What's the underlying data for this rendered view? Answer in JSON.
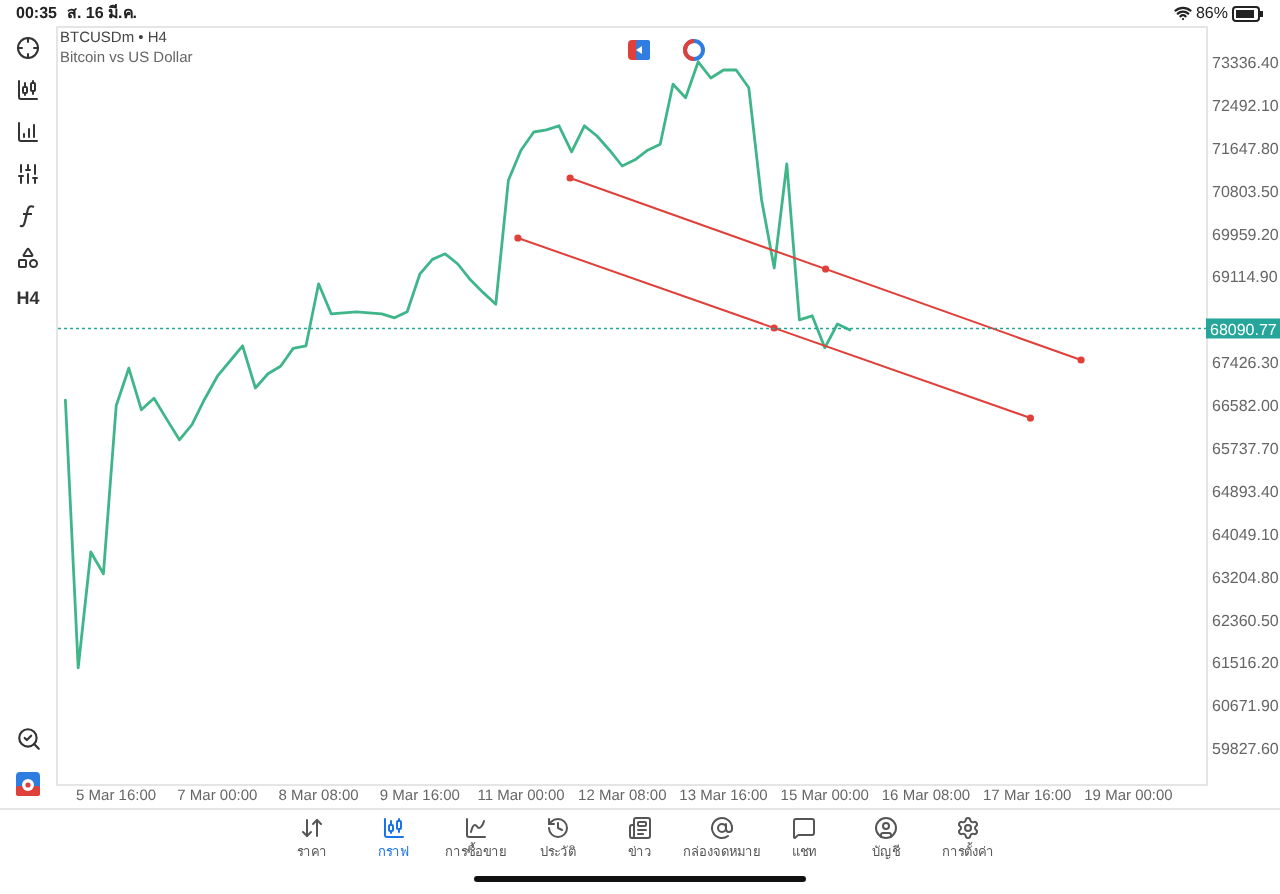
{
  "status_bar": {
    "time": "00:35",
    "date": "ส. 16 มี.ค.",
    "battery": "86%"
  },
  "chart_header": {
    "symbol": "BTCUSDm • H4",
    "description": "Bitcoin vs US Dollar"
  },
  "toolbar": {
    "timeframe": "H4"
  },
  "chart": {
    "chart_data": {
      "type": "line",
      "ylim": [
        59124,
        74045
      ],
      "categories": [
        null,
        null,
        null,
        null,
        "5 Mar 16:00",
        null,
        null,
        null,
        null,
        null,
        null,
        null,
        "7 Mar 00:00",
        null,
        null,
        null,
        null,
        null,
        null,
        null,
        "8 Mar 08:00",
        null,
        null,
        null,
        null,
        null,
        null,
        null,
        "9 Mar 16:00",
        null,
        null,
        null,
        null,
        null,
        null,
        null,
        "11 Mar 00:00",
        null,
        null,
        null,
        null,
        null,
        null,
        null,
        "12 Mar 08:00",
        null,
        null,
        null,
        null,
        null,
        null,
        null,
        "13 Mar 16:00",
        null,
        null,
        null,
        null,
        null,
        null,
        null,
        "15 Mar 00:00",
        null,
        null,
        null,
        null,
        null,
        null,
        null,
        "16 Mar 08:00",
        null,
        null,
        null,
        null,
        null,
        null,
        null,
        "17 Mar 16:00",
        null,
        null,
        null,
        null,
        null,
        null,
        null,
        "19 Mar 00:00",
        null,
        null,
        null,
        null,
        null,
        null
      ],
      "series": [
        {
          "color": "#3fb58a",
          "values": [
            66680,
            61410,
            63690,
            63260,
            66570,
            67310,
            66490,
            66720,
            66300,
            65900,
            66200,
            66700,
            67150,
            67450,
            67750,
            66920,
            67200,
            67350,
            67700,
            67750,
            68970,
            68380,
            68400,
            68420,
            68400,
            68380,
            68300,
            68420,
            69160,
            69450,
            69560,
            69360,
            69050,
            68800,
            68570,
            71010,
            71600,
            71960,
            72000,
            72080,
            71570,
            72080,
            71880,
            71600,
            71290,
            71410,
            71600,
            71720,
            72900,
            72630,
            73340,
            73020,
            73180,
            73180,
            72830,
            70620,
            69280,
            71330,
            68260,
            68340,
            67710,
            68180,
            68060,
            null,
            null,
            null,
            null,
            null,
            null,
            null,
            null,
            null,
            null,
            null,
            null,
            null,
            null,
            null,
            null,
            null,
            null,
            null,
            null,
            null,
            null,
            null,
            null,
            null,
            null,
            null,
            null
          ]
        }
      ],
      "yticks": [
        {
          "value": 73336.4,
          "label": "73336.40"
        },
        {
          "value": 72492.1,
          "label": "72492.10"
        },
        {
          "value": 71647.8,
          "label": "71647.80"
        },
        {
          "value": 70803.5,
          "label": "70803.50"
        },
        {
          "value": 69959.2,
          "label": "69959.20"
        },
        {
          "value": 69114.9,
          "label": "69114.90"
        },
        {
          "value": 67426.3,
          "label": "67426.30"
        },
        {
          "value": 66582,
          "label": "66582.00"
        },
        {
          "value": 65737.7,
          "label": "65737.70"
        },
        {
          "value": 64893.4,
          "label": "64893.40"
        },
        {
          "value": 64049.1,
          "label": "64049.10"
        },
        {
          "value": 63204.8,
          "label": "63204.80"
        },
        {
          "value": 62360.5,
          "label": "62360.50"
        },
        {
          "value": 61516.2,
          "label": "61516.20"
        },
        {
          "value": 60671.9,
          "label": "60671.90"
        },
        {
          "value": 59827.6,
          "label": "59827.60"
        }
      ]
    },
    "current_price": {
      "price": "68090.77",
      "color": "#26a69a"
    },
    "trend_lines": [
      {
        "color": "#e0403a"
      },
      {
        "color": "#e0403a"
      }
    ]
  },
  "tabs": [
    {
      "label": "ราคา",
      "selected": false
    },
    {
      "label": "กราฟ",
      "selected": true
    },
    {
      "label": "การซื้อขาย",
      "selected": false
    },
    {
      "label": "ประวัติ",
      "selected": false
    },
    {
      "label": "ข่าว",
      "selected": false
    },
    {
      "label": "กล่องจดหมาย",
      "selected": false
    },
    {
      "label": "แชท",
      "selected": false
    },
    {
      "label": "บัญชี",
      "selected": false
    },
    {
      "label": "การตั้งค่า",
      "selected": false
    }
  ]
}
